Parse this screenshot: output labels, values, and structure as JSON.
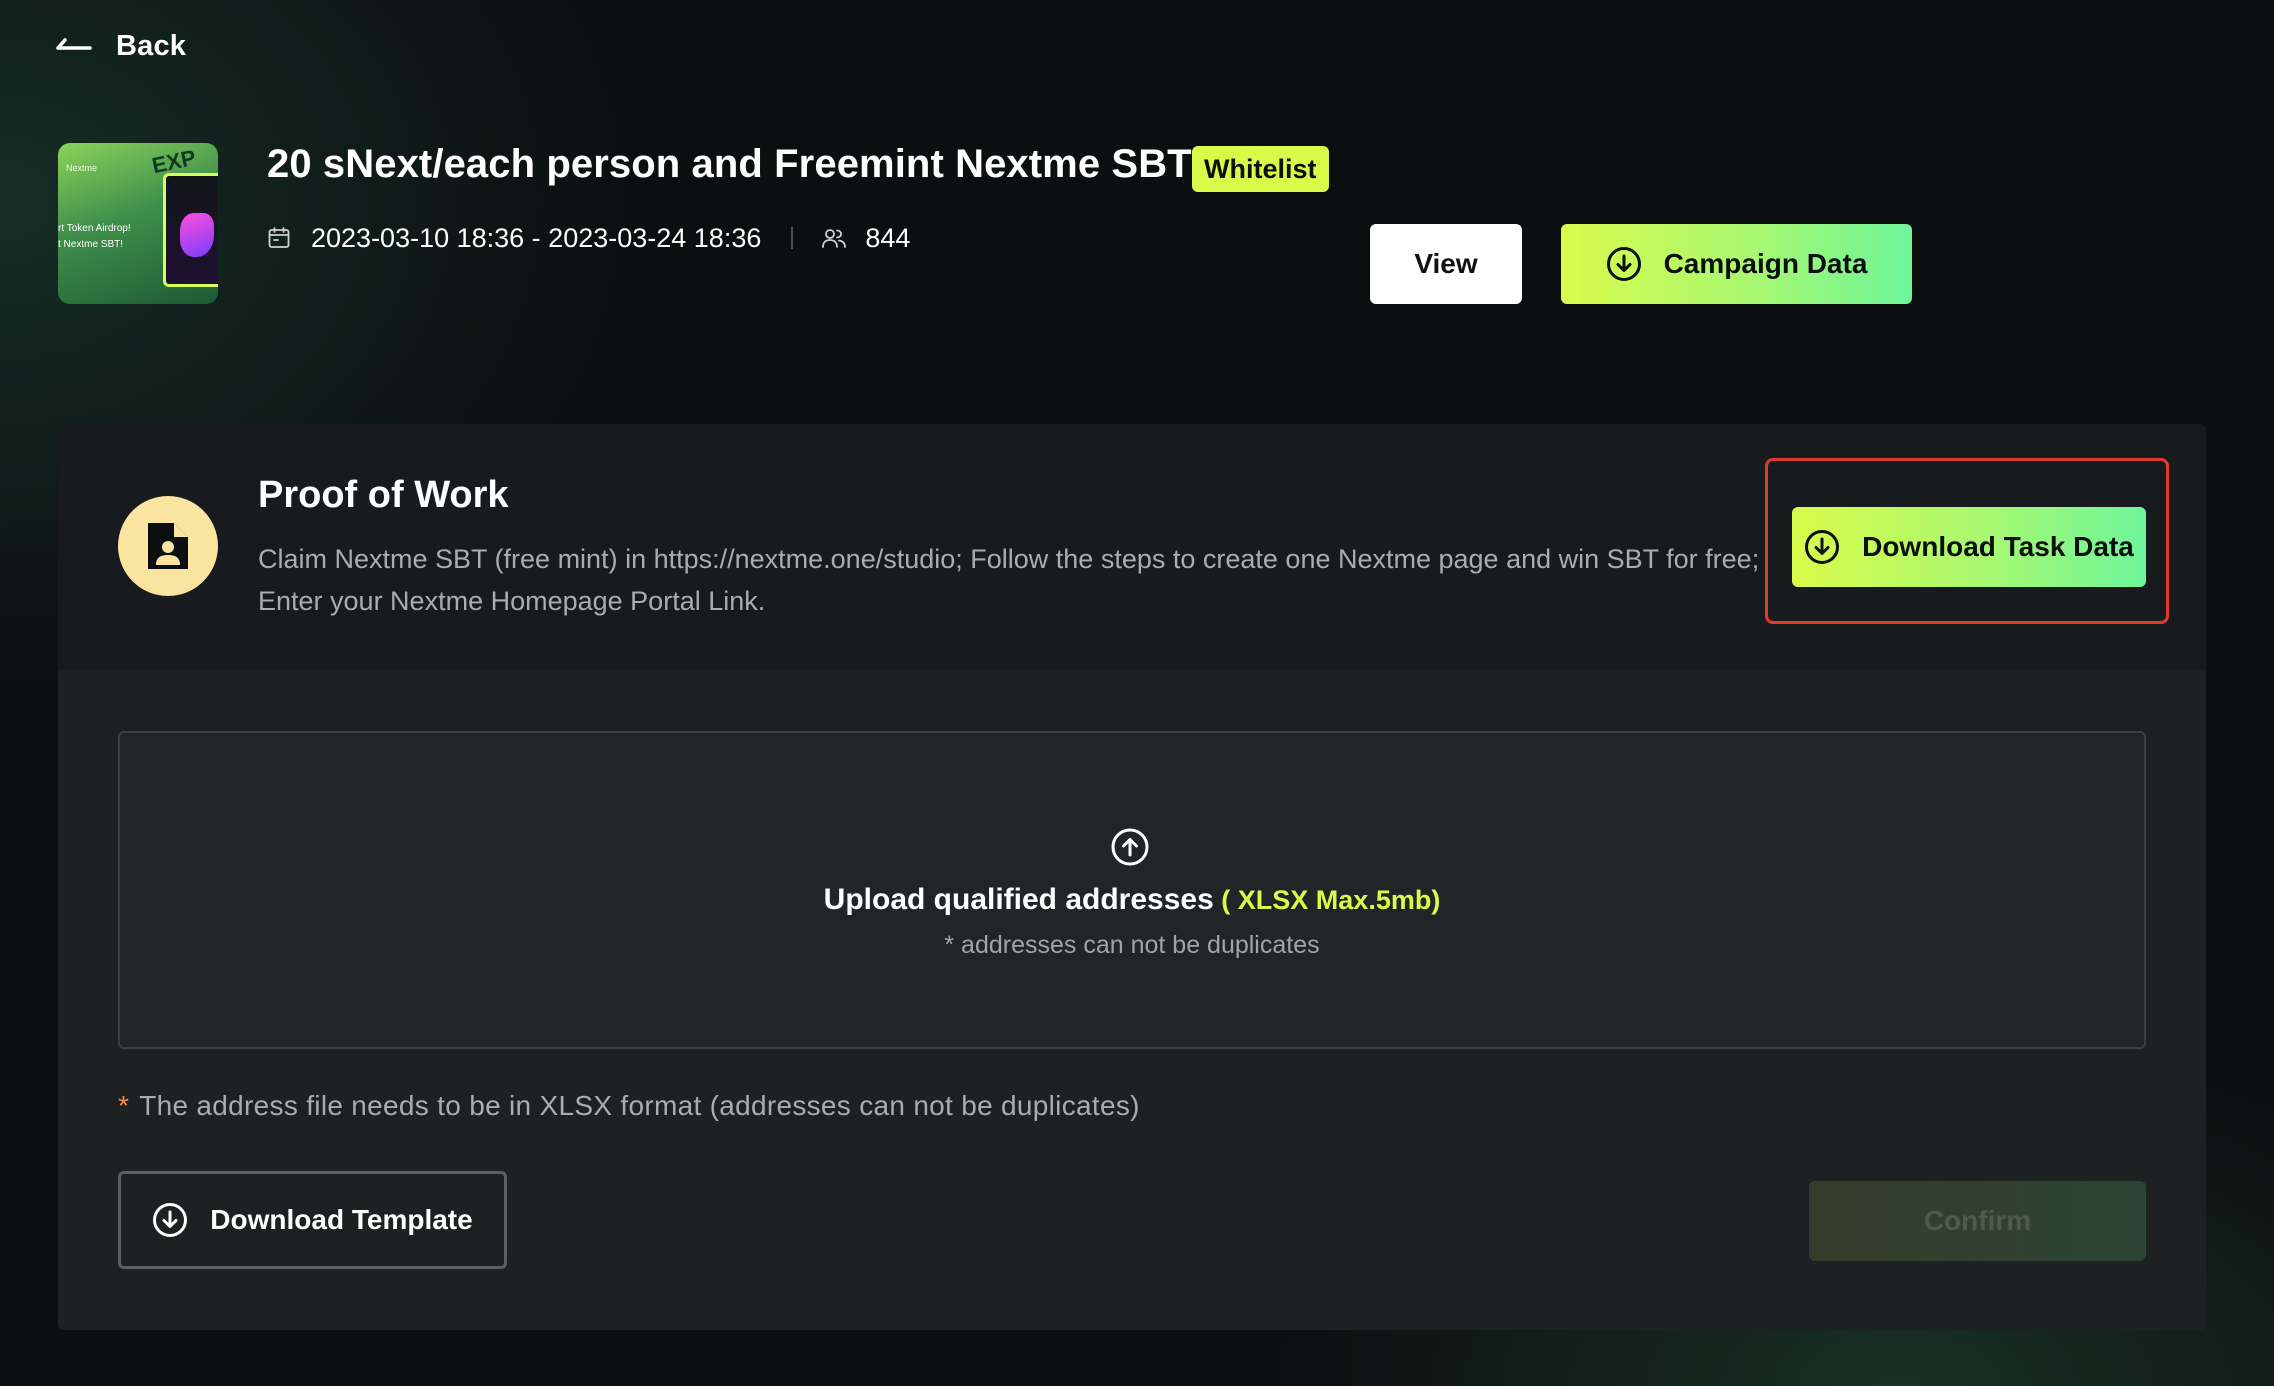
{
  "nav": {
    "back_label": "Back"
  },
  "campaign": {
    "thumbnail": {
      "brand": "Nextme",
      "badge": "EXP",
      "line1": "rt Token Airdrop!",
      "line2": "t Nextme SBT!"
    },
    "title": "20 sNext/each person and Freemint Nextme SBT",
    "badge": "Whitelist",
    "date_range": "2023-03-10 18:36 - 2023-03-24 18:36",
    "participants": "844",
    "view_label": "View",
    "campaign_data_label": "Campaign Data"
  },
  "task": {
    "title": "Proof of Work",
    "description": "Claim Nextme SBT (free mint) in https://nextme.one/studio; Follow the steps to create one Nextme page and win SBT for free; Enter your Nextme Homepage Portal Link.",
    "download_label": "Download Task Data"
  },
  "upload": {
    "title": "Upload qualified addresses",
    "format_hint": " ( XLSX Max.5mb)",
    "note": "* addresses can not be duplicates"
  },
  "hint": {
    "star": "*",
    "text": "The address file needs to be in XLSX format (addresses can not be duplicates)"
  },
  "actions": {
    "template_label": "Download Template",
    "confirm_label": "Confirm"
  },
  "colors": {
    "accent": "#d8fb4a",
    "accent_end": "#6df59b",
    "highlight_border": "#e23a2a",
    "panel": "#1e2122",
    "background": "#0c0f10"
  }
}
